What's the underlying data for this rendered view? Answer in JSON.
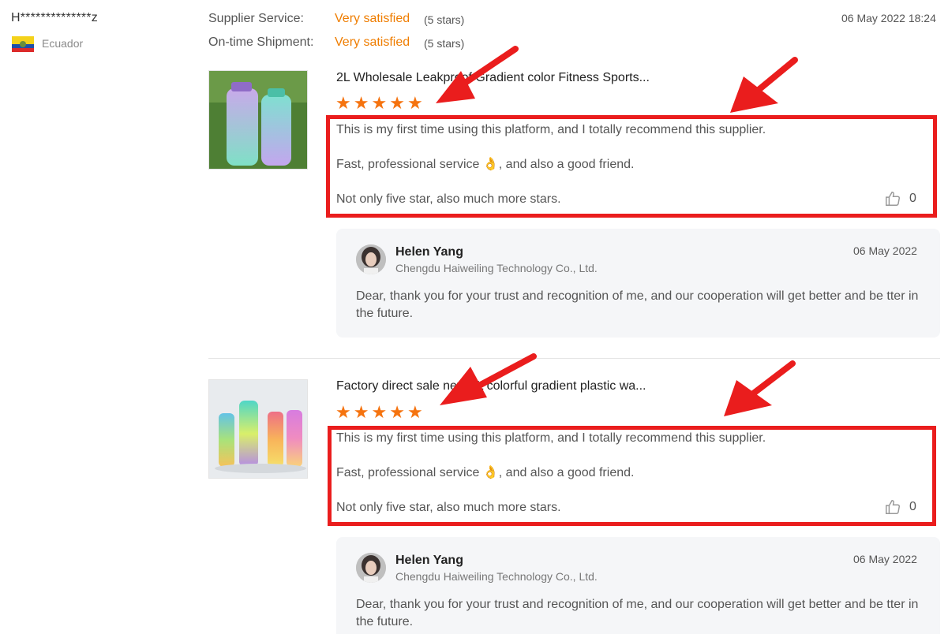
{
  "reviewer": {
    "name": "H**************z",
    "country": "Ecuador"
  },
  "ratings": {
    "supplier_service": {
      "label": "Supplier Service:",
      "value": "Very satisfied",
      "stars": "(5 stars)"
    },
    "shipment": {
      "label": "On-time Shipment:",
      "value": "Very satisfied",
      "stars": "(5 stars)"
    }
  },
  "review_date": "06 May 2022 18:24",
  "products": [
    {
      "title": "2L Wholesale Leakproof Gradient color Fitness Sports...",
      "rating": 5,
      "review_lines": [
        "This is my first time using this platform, and I totally recommend this supplier.",
        "Fast, professional service 👌, and also a good friend.",
        "Not only five star, also much more stars."
      ],
      "likes": "0",
      "reply": {
        "name": "Helen Yang",
        "company": "Chengdu Haiweiling Technology Co., Ltd.",
        "date": "06 May 2022",
        "text": "Dear, thank you for your trust and recognition of me, and our cooperation will get better and be tter in the future."
      }
    },
    {
      "title": "Factory direct sale new 1L colorful gradient plastic wa...",
      "rating": 5,
      "review_lines": [
        "This is my first time using this platform, and I totally recommend this supplier.",
        "Fast, professional service 👌, and also a good friend.",
        "Not only five star, also much more stars."
      ],
      "likes": "0",
      "reply": {
        "name": "Helen Yang",
        "company": "Chengdu Haiweiling Technology Co., Ltd.",
        "date": "06 May 2022",
        "text": "Dear, thank you for your trust and recognition of me, and our cooperation will get better and be tter in the future."
      }
    }
  ],
  "icons": {
    "star": "star-icon",
    "like": "thumbs-up-icon",
    "arrow": "red-arrow-annotation"
  },
  "colors": {
    "accent": "#ef7d00",
    "star": "#f5730f",
    "annotation": "#ea1d1d"
  }
}
